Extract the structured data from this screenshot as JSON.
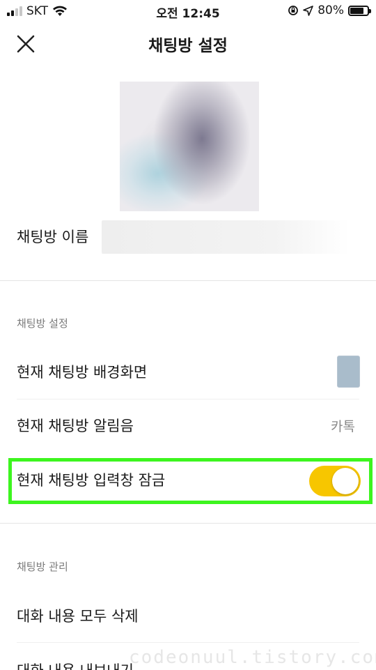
{
  "status_bar": {
    "carrier": "SKT",
    "time": "오전 12:45",
    "battery": "80%",
    "battery_level": 0.8
  },
  "header": {
    "title": "채팅방 설정",
    "close_icon": "close-icon"
  },
  "profile": {
    "name_label": "채팅방 이름",
    "name_value": ""
  },
  "settings_section": {
    "heading": "채팅방 설정",
    "wallpaper_label": "현재 채팅방 배경화면",
    "wallpaper_color": "#a9bccb",
    "notification_label": "현재 채팅방 알림음",
    "notification_value": "카톡",
    "lock_input_label": "현재 채팅방 입력창 잠금",
    "lock_input_enabled": true,
    "toggle_color": "#f7c600"
  },
  "manage_section": {
    "heading": "채팅방 관리",
    "delete_all_label": "대화 내용 모두 삭제",
    "export_label": "대화 내용 내보내기"
  },
  "highlight_color": "#3df51f",
  "watermark": "codeonuul.tistory.com"
}
